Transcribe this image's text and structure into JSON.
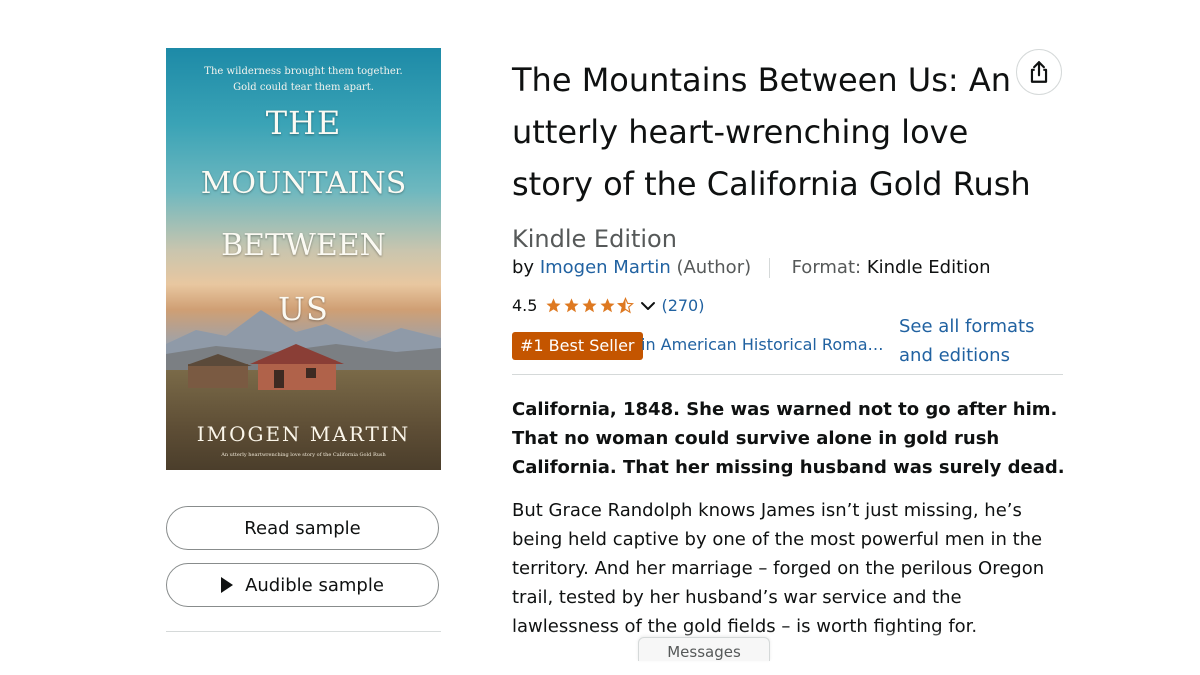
{
  "cover": {
    "tagline_1": "The wilderness brought them together.",
    "tagline_2": "Gold could tear them apart.",
    "title_lines": [
      "THE",
      "MOUNTAINS",
      "BETWEEN",
      "US"
    ],
    "author": "IMOGEN MARTIN",
    "subtitle": "An utterly heartwrenching love story of the California Gold Rush"
  },
  "samples": {
    "read_label": "Read sample",
    "audible_label": "Audible sample"
  },
  "product": {
    "title": "The Mountains Between Us: An utterly heart-wrenching love story of the California Gold Rush",
    "edition": "Kindle Edition",
    "by": "by",
    "author": "Imogen Martin",
    "author_role": "(Author)",
    "format_label": "Format:",
    "format_value": "Kindle Edition",
    "rating": "4.5",
    "rating_stars": 4.5,
    "review_count": "(270)",
    "badge": "#1 Best Seller",
    "category": "in American Historical Roma…",
    "formats_link": "See all formats and editions",
    "description_bold": "California, 1848. She was warned not to go after him. That no woman could survive alone in gold rush California. That her missing husband was surely dead.",
    "description": "But Grace Randolph knows James isn’t just missing, he’s being held captive by one of the most powerful men in the territory. And her marriage – forged on the perilous Oregon trail, tested by her husband’s war service and the lawlessness of the gold fields – is worth fighting for."
  },
  "footer": {
    "messages_label": "Messages"
  },
  "colors": {
    "link": "#2162a1",
    "star": "#de7921",
    "badge": "#c45500",
    "text": "#0f1111"
  }
}
